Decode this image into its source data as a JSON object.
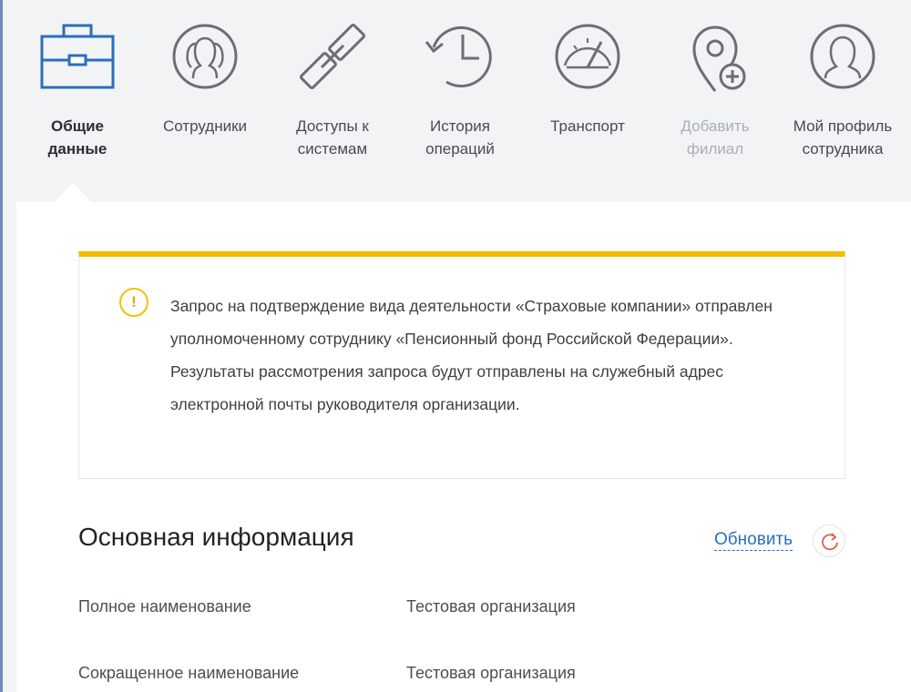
{
  "nav": {
    "items": [
      {
        "label_line1": "Общие",
        "label_line2": "данные",
        "icon": "briefcase-icon",
        "state": "active"
      },
      {
        "label_line1": "Сотрудники",
        "label_line2": "",
        "icon": "employees-icon",
        "state": "normal"
      },
      {
        "label_line1": "Доступы к",
        "label_line2": "системам",
        "icon": "link-chain-icon",
        "state": "normal"
      },
      {
        "label_line1": "История",
        "label_line2": "операций",
        "icon": "history-clock-icon",
        "state": "normal"
      },
      {
        "label_line1": "Транспорт",
        "label_line2": "",
        "icon": "speedometer-icon",
        "state": "normal"
      },
      {
        "label_line1": "Добавить",
        "label_line2": "филиал",
        "icon": "add-location-icon",
        "state": "disabled"
      },
      {
        "label_line1": "Мой профиль",
        "label_line2": "сотрудника",
        "icon": "user-profile-icon",
        "state": "normal"
      }
    ]
  },
  "alert": {
    "icon_glyph": "!",
    "text": "Запрос на подтверждение вида деятельности «Страховые компании» отправлен уполномоченному сотруднику «Пенсионный фонд Российской Федерации». Результаты рассмотрения запроса будут отправлены на служебный адрес электронной почты руководителя организации."
  },
  "main_info": {
    "title": "Основная информация",
    "refresh_label": "Обновить",
    "fields": [
      {
        "label": "Полное наименование",
        "value": "Тестовая организация"
      },
      {
        "label": "Сокращенное наименование",
        "value": "Тестовая организация"
      }
    ]
  },
  "colors": {
    "accent_blue": "#2b6fb8",
    "alert_yellow": "#f2bd00",
    "icon_gray": "#6b6f73",
    "refresh_red": "#e05a4e"
  }
}
